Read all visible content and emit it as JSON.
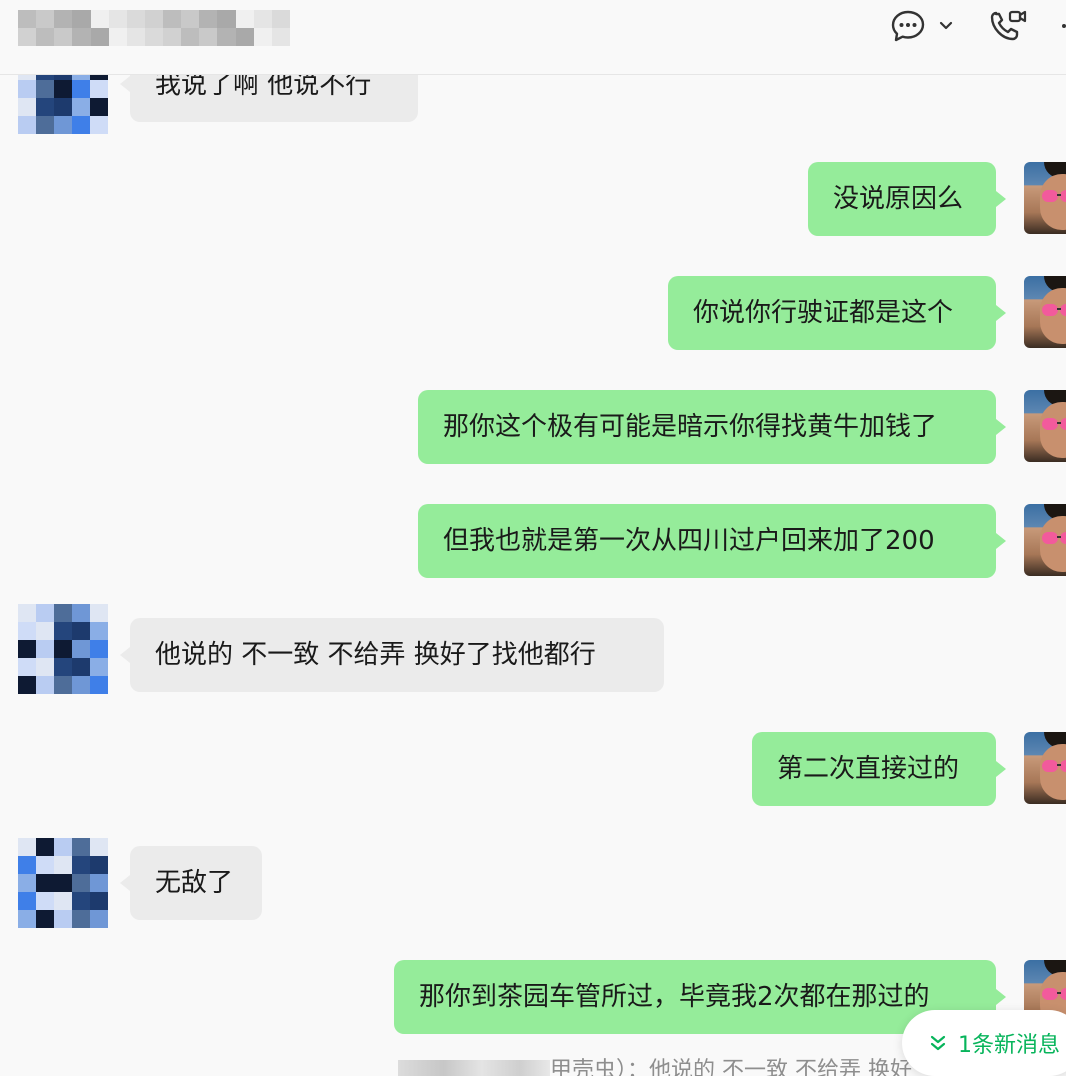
{
  "header": {
    "chat_icon": "chat-bubble-icon",
    "dropdown_icon": "chevron-down-icon",
    "call_icon": "phone-video-icon"
  },
  "messages": [
    {
      "side": "in",
      "text": "我说了啊  他说不行"
    },
    {
      "side": "out",
      "text": "没说原因么"
    },
    {
      "side": "out",
      "text": "你说你行驶证都是这个"
    },
    {
      "side": "out",
      "text": "那你这个极有可能是暗示你得找黄牛加钱了"
    },
    {
      "side": "out",
      "text": "但我也就是第一次从四川过户回来加了200"
    },
    {
      "side": "in",
      "text": "他说的  不一致  不给弄 换好了找他都行"
    },
    {
      "side": "out",
      "text": "第二次直接过的"
    },
    {
      "side": "in",
      "text": "无敌了"
    },
    {
      "side": "out",
      "text": "那你到茶园车管所过，毕竟我2次都在那过的"
    }
  ],
  "quote_preview": {
    "text": "甲壳虫）：他说的  不一致  不给弄 换好了"
  },
  "new_message_badge": {
    "label": "1条新消息"
  },
  "colors": {
    "outgoing_bubble": "#95ec9a",
    "incoming_bubble": "#ebebeb",
    "accent_green": "#07b45b",
    "background": "#f9f9f9"
  }
}
